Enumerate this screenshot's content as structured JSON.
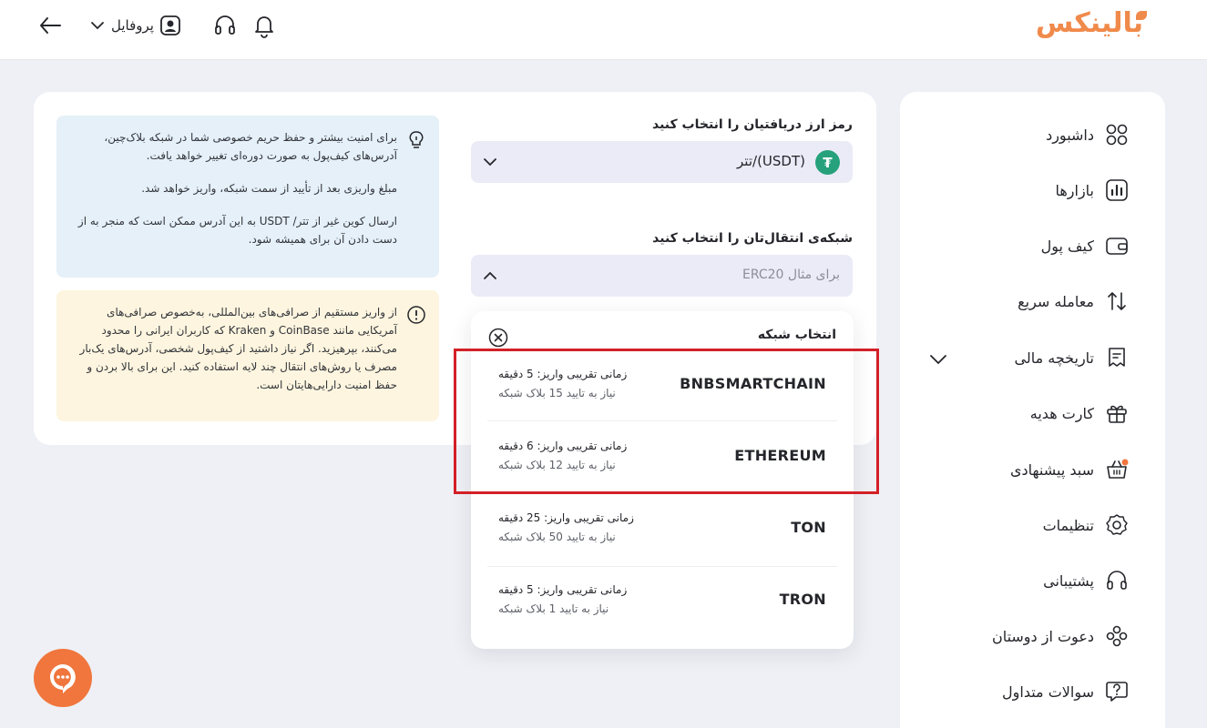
{
  "header": {
    "brand": "بالینکس",
    "profile_label": "پروفایل"
  },
  "notices": {
    "blue_1": "برای امنیت بیشتر و حفظ حریم خصوصی شما در شبکه بلاک‌چین، آدرس‌های کیف‌پول به صورت دوره‌ای تغییر خواهد یافت.",
    "blue_2": "مبلغ واریزی بعد از تأیید از سمت شبکه، واریز خواهد شد.",
    "blue_3": "ارسال کوین غیر از تتر/ USDT به این آدرس ممکن است که منجر به از دست دادن آن برای همیشه شود.",
    "yellow": "از واریز مستقیم از صرافی‌های بین‌المللی، به‌خصوص صرافی‌های آمریکایی مانند CoinBase و Kraken که کاربران ایرانی را محدود می‌کنند، بپرهیزید. اگر نیاز داشتید از کیف‌پول شخصی، آدرس‌های یک‌بار مصرف یا روش‌های انتقال چند لایه استفاده کنید. این برای بالا بردن و حفظ امنیت دارایی‌هایتان است."
  },
  "form": {
    "currency_label": "رمز ارز دریافتیان را انتخاب کنید",
    "currency_value": "تتر/(USDT)",
    "network_label": "شبکه‌ی انتقال‌تان را انتخاب کنید",
    "network_placeholder": "برای مثال ERC20"
  },
  "network_panel": {
    "title": "انتخاب شبکه",
    "items": [
      {
        "name": "BNBSMARTCHAIN",
        "time": "زمانی تقریبی واریز: 5 دقیقه",
        "conf": "نیاز به تایید 15 بلاک شبکه"
      },
      {
        "name": "ETHEREUM",
        "time": "زمانی تقریبی واریز: 6 دقیقه",
        "conf": "نیاز به تایید 12 بلاک شبکه"
      },
      {
        "name": "TON",
        "time": "زمانی تقریبی واریز: 25 دقیقه",
        "conf": "نیاز به تایید 50 بلاک شبکه"
      },
      {
        "name": "TRON",
        "time": "زمانی تقریبی واریز: 5 دقیقه",
        "conf": "نیاز به تایید 1 بلاک شبکه"
      }
    ]
  },
  "sidebar": {
    "items": [
      {
        "label": "داشبورد",
        "icon": "dashboard-icon"
      },
      {
        "label": "بازارها",
        "icon": "markets-icon"
      },
      {
        "label": "کیف پول",
        "icon": "wallet-icon"
      },
      {
        "label": "معامله سریع",
        "icon": "swap-icon"
      },
      {
        "label": "تاریخچه مالی",
        "icon": "history-icon"
      },
      {
        "label": "کارت هدیه",
        "icon": "gift-icon"
      },
      {
        "label": "سبد پیشنهادی",
        "icon": "basket-icon"
      },
      {
        "label": "تنظیمات",
        "icon": "gear-icon"
      },
      {
        "label": "پشتیبانی",
        "icon": "headset-icon"
      },
      {
        "label": "دعوت از دوستان",
        "icon": "invite-icon"
      },
      {
        "label": "سوالات متداول",
        "icon": "faq-icon"
      }
    ]
  },
  "colors": {
    "brand": "#f08a4b",
    "highlight": "#d32027",
    "tether": "#26a17b"
  }
}
